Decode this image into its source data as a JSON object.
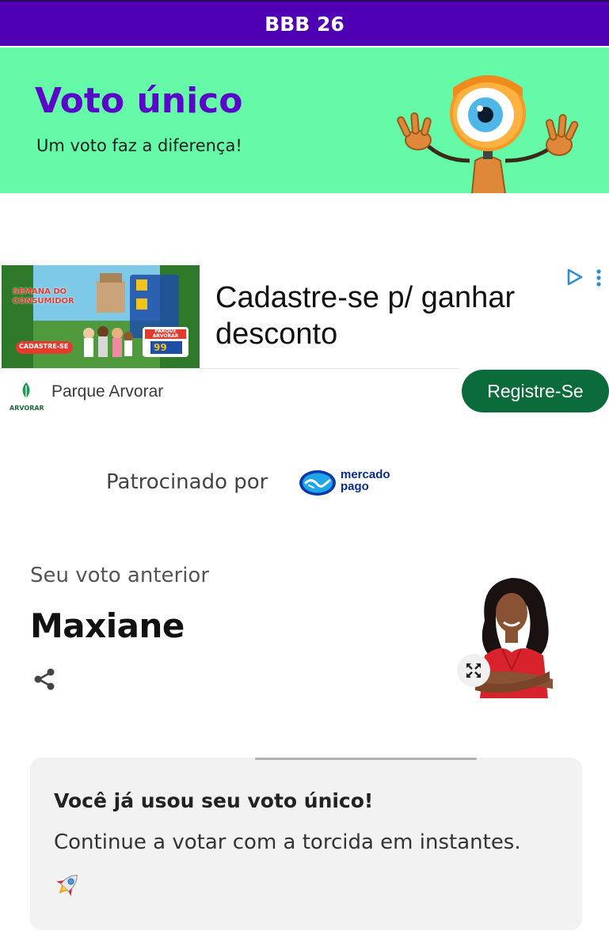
{
  "topbar": {
    "title": "BBB 26"
  },
  "hero": {
    "title": "Voto único",
    "subtitle": "Um voto faz a diferença!",
    "mascot_icon": "big-brother-eye-mascot"
  },
  "ad": {
    "image_texts": {
      "line1": "SEMANA DO",
      "line2": "CONSUMIDOR",
      "cta": "CADASTRE-SE",
      "badge_line1": "PARQUE",
      "badge_line2": "ARVORAR",
      "price": "99"
    },
    "headline": "Cadastre-se p/ ganhar desconto",
    "advertiser": "Parque Arvorar",
    "logo_text": "ARVORAR",
    "cta": "Registre-Se"
  },
  "sponsor": {
    "label": "Patrocinado por",
    "brand_line1": "mercado",
    "brand_line2": "pago"
  },
  "previous_vote": {
    "label": "Seu voto anterior",
    "name": "Maxiane"
  },
  "notice": {
    "title": "Você já usou seu voto único!",
    "text": "Continue a votar com a torcida em instantes."
  },
  "colors": {
    "topbar": "#5000b4",
    "hero_bg": "#64faa8",
    "hero_title": "#5a06c8",
    "ad_cta": "#0b6b3a",
    "card_bg": "#f2f2f2"
  }
}
